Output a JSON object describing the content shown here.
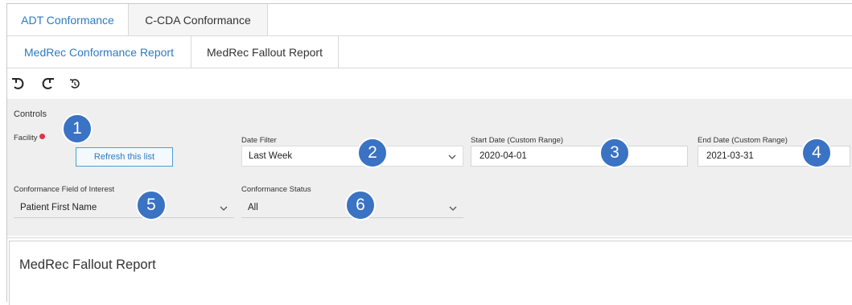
{
  "tabs_row1": [
    {
      "label": "ADT Conformance",
      "active": true
    },
    {
      "label": "C-CDA Conformance",
      "active": false
    }
  ],
  "tabs_row2": [
    {
      "label": "MedRec Conformance Report",
      "active": true
    },
    {
      "label": "MedRec Fallout Report",
      "active": false
    }
  ],
  "toolbar": {
    "icons": [
      "undo-icon",
      "redo-icon",
      "reset-icon"
    ]
  },
  "controls": {
    "title": "Controls",
    "facility": {
      "label": "Facility",
      "refresh_label": "Refresh this list"
    },
    "date_filter": {
      "label": "Date Filter",
      "value": "Last Week"
    },
    "start_date": {
      "label": "Start Date (Custom Range)",
      "value": "2020-04-01"
    },
    "end_date": {
      "label": "End Date (Custom Range)",
      "value": "2021-03-31"
    },
    "field_of_interest": {
      "label": "Conformance Field of Interest",
      "value": "Patient First Name"
    },
    "status": {
      "label": "Conformance Status",
      "value": "All"
    }
  },
  "callouts": [
    "1",
    "2",
    "3",
    "4",
    "5",
    "6"
  ],
  "report": {
    "title": "MedRec Fallout Report"
  },
  "colors": {
    "accent": "#2b7bc4",
    "callout": "#3a72c4",
    "required": "#e0334d",
    "panel": "#efefef"
  }
}
